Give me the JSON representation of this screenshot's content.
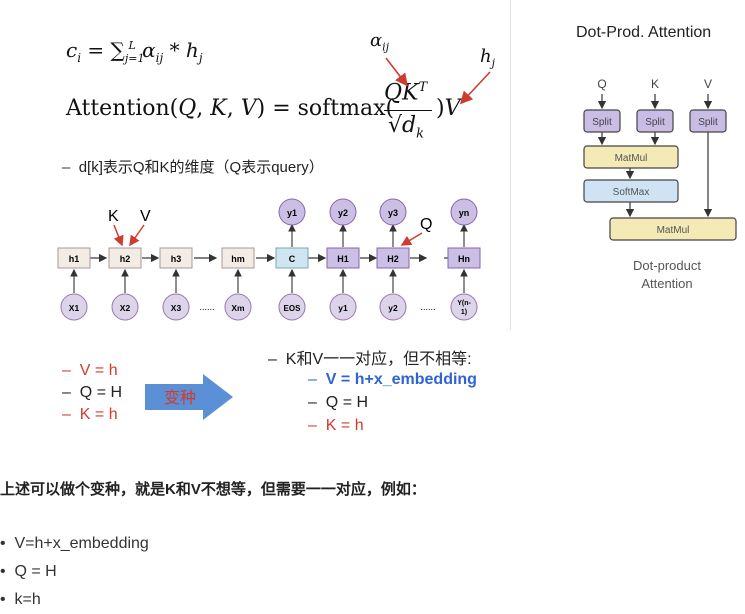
{
  "formula": {
    "line1": "c_i = ∑_{j=1}^{L} α_{ij} * h_j",
    "line2_left": "Attention(Q, K, V) = softmax(",
    "numerator": "QK",
    "numerator_sup": "T",
    "denominator": "√d",
    "denominator_sub": "k",
    "line2_right": ")V",
    "alpha_label": "α",
    "alpha_sub": "ij",
    "hj_label": "h",
    "hj_sub": "j"
  },
  "note_dk": "d[k]表示Q和K的维度（Q表示query）",
  "seq": {
    "k_label": "K",
    "v_label": "V",
    "q_label": "Q",
    "encoder_nodes": [
      "h1",
      "h2",
      "h3",
      "hm"
    ],
    "decoder_nodes": [
      "C",
      "H1",
      "H2",
      "Hn"
    ],
    "outputs": [
      "y1",
      "y2",
      "y3",
      "yn"
    ],
    "inputs_enc": [
      "X1",
      "X2",
      "X3",
      "Xm"
    ],
    "inputs_dec": [
      "EOS",
      "y1",
      "y2",
      "Y(n-1)"
    ],
    "ellipsis": "......"
  },
  "left_list": [
    {
      "text": "V = h",
      "color": "#d03b2f"
    },
    {
      "text": "Q = H",
      "color": "#222222"
    },
    {
      "text": "K = h",
      "color": "#d03b2f"
    }
  ],
  "arrow_label": "变种",
  "right_header": "K和V一一对应，但不相等:",
  "right_list": [
    {
      "text": "V = h+x_embedding",
      "color": "#2f63d6"
    },
    {
      "text": "Q = H",
      "color": "#222222"
    },
    {
      "text": "K = h",
      "color": "#d03b2f"
    }
  ],
  "attention_diagram": {
    "title": "Dot-Prod. Attention",
    "inputs": [
      "Q",
      "K",
      "V"
    ],
    "split": "Split",
    "matmul": "MatMul",
    "softmax": "SoftMax",
    "caption_line1": "Dot-product",
    "caption_line2": "Attention"
  },
  "summary": "上述可以做个变种，就是K和V不想等，但需要一一对应，例如：",
  "bullets": [
    "V=h+x_embedding",
    "Q = H",
    "k=h"
  ],
  "colors": {
    "red": "#d03b2f",
    "blue": "#2f63d6",
    "arrow_blue": "#5b8fd6",
    "enc_box": "#f2ece4",
    "dec_box": "#cbbfe6",
    "c_box": "#cfe6f2",
    "split_box": "#c9bde6",
    "matmul_box": "#f4eab6",
    "softmax_box": "#cfe3f4"
  }
}
